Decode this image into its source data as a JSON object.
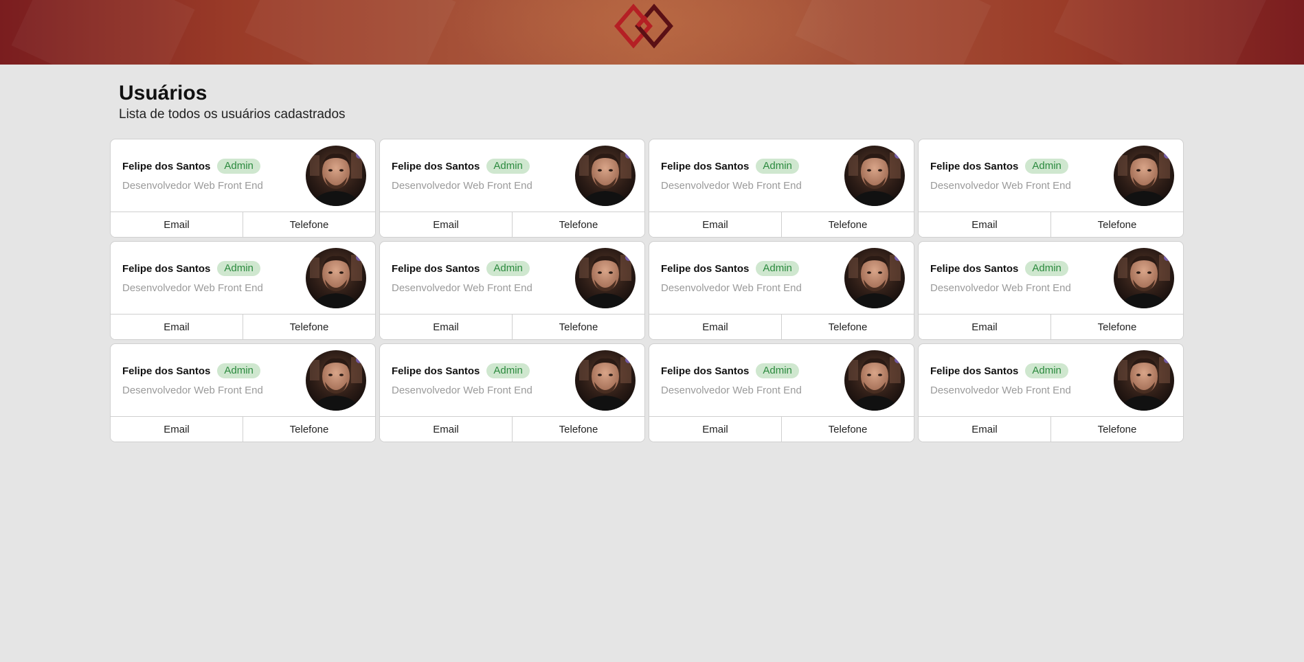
{
  "header": {
    "logo_icon": "diamond-links-logo",
    "brand_colors": [
      "#7a1d1f",
      "#b0603f"
    ],
    "logo_colors": [
      "#b51f24",
      "#5a1015"
    ]
  },
  "page": {
    "title": "Usuários",
    "subtitle": "Lista de todos os usuários cadastrados"
  },
  "users": [
    {
      "name": "Felipe dos Santos",
      "badge": "Admin",
      "role": "Desenvolvedor Web Front End",
      "email_label": "Email",
      "phone_label": "Telefone"
    },
    {
      "name": "Felipe dos Santos",
      "badge": "Admin",
      "role": "Desenvolvedor Web Front End",
      "email_label": "Email",
      "phone_label": "Telefone"
    },
    {
      "name": "Felipe dos Santos",
      "badge": "Admin",
      "role": "Desenvolvedor Web Front End",
      "email_label": "Email",
      "phone_label": "Telefone"
    },
    {
      "name": "Felipe dos Santos",
      "badge": "Admin",
      "role": "Desenvolvedor Web Front End",
      "email_label": "Email",
      "phone_label": "Telefone"
    },
    {
      "name": "Felipe dos Santos",
      "badge": "Admin",
      "role": "Desenvolvedor Web Front End",
      "email_label": "Email",
      "phone_label": "Telefone"
    },
    {
      "name": "Felipe dos Santos",
      "badge": "Admin",
      "role": "Desenvolvedor Web Front End",
      "email_label": "Email",
      "phone_label": "Telefone"
    },
    {
      "name": "Felipe dos Santos",
      "badge": "Admin",
      "role": "Desenvolvedor Web Front End",
      "email_label": "Email",
      "phone_label": "Telefone"
    },
    {
      "name": "Felipe dos Santos",
      "badge": "Admin",
      "role": "Desenvolvedor Web Front End",
      "email_label": "Email",
      "phone_label": "Telefone"
    },
    {
      "name": "Felipe dos Santos",
      "badge": "Admin",
      "role": "Desenvolvedor Web Front End",
      "email_label": "Email",
      "phone_label": "Telefone"
    },
    {
      "name": "Felipe dos Santos",
      "badge": "Admin",
      "role": "Desenvolvedor Web Front End",
      "email_label": "Email",
      "phone_label": "Telefone"
    },
    {
      "name": "Felipe dos Santos",
      "badge": "Admin",
      "role": "Desenvolvedor Web Front End",
      "email_label": "Email",
      "phone_label": "Telefone"
    },
    {
      "name": "Felipe dos Santos",
      "badge": "Admin",
      "role": "Desenvolvedor Web Front End",
      "email_label": "Email",
      "phone_label": "Telefone"
    }
  ]
}
